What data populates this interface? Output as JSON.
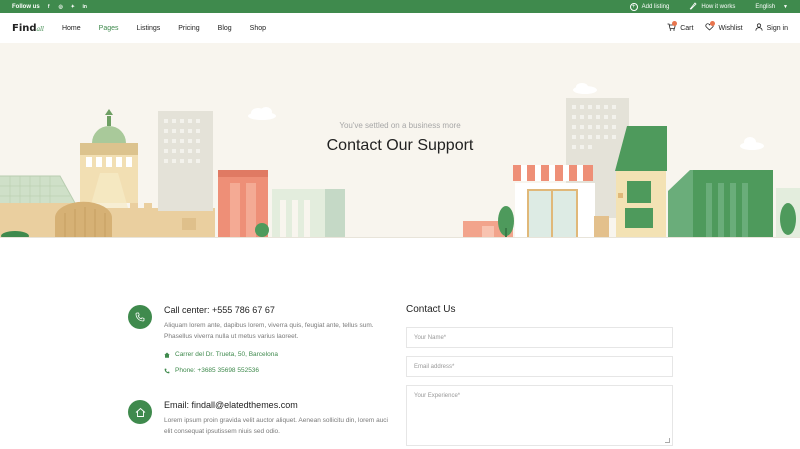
{
  "topbar": {
    "follow_label": "Follow us",
    "social_icons": [
      "facebook-icon",
      "instagram-icon",
      "twitter-icon",
      "linkedin-icon"
    ],
    "add_listing": "Add listing",
    "how_it_works": "How it works",
    "language": "English"
  },
  "header": {
    "logo_main": "Find",
    "logo_suffix": "all",
    "nav": [
      "Home",
      "Pages",
      "Listings",
      "Pricing",
      "Blog",
      "Shop"
    ],
    "active_nav": "Pages",
    "cart": "Cart",
    "wishlist": "Wishlist",
    "sign_in": "Sign in"
  },
  "hero": {
    "subtitle": "You've settled on a business more",
    "title": "Contact Our Support"
  },
  "contact": {
    "phone": {
      "title": "Call center: +555 786 67 67",
      "text": "Aliquam lorem ante, dapibus lorem, viverra quis, feugiat ante, tellus sum. Phasellus viverra nulla ut metus varius laoreet.",
      "address": "Carrer del Dr. Trueta, 50, Barcelona",
      "tel": "Phone: +3685 35698 552536"
    },
    "email": {
      "title": "Email: findall@elatedthemes.com",
      "text": "Lorem ipsum proin gravida velit auctor aliquet. Aenean sollicitu din, lorem auci elit consequat ipsutissem niuis sed odio."
    }
  },
  "form": {
    "title": "Contact Us",
    "name_placeholder": "Your Name*",
    "email_placeholder": "Email address*",
    "message_placeholder": "Your Experience*"
  },
  "colors": {
    "brand_green": "#3f8a4d",
    "accent_orange": "#e8744d",
    "hero_bg": "#f8f5ee"
  }
}
